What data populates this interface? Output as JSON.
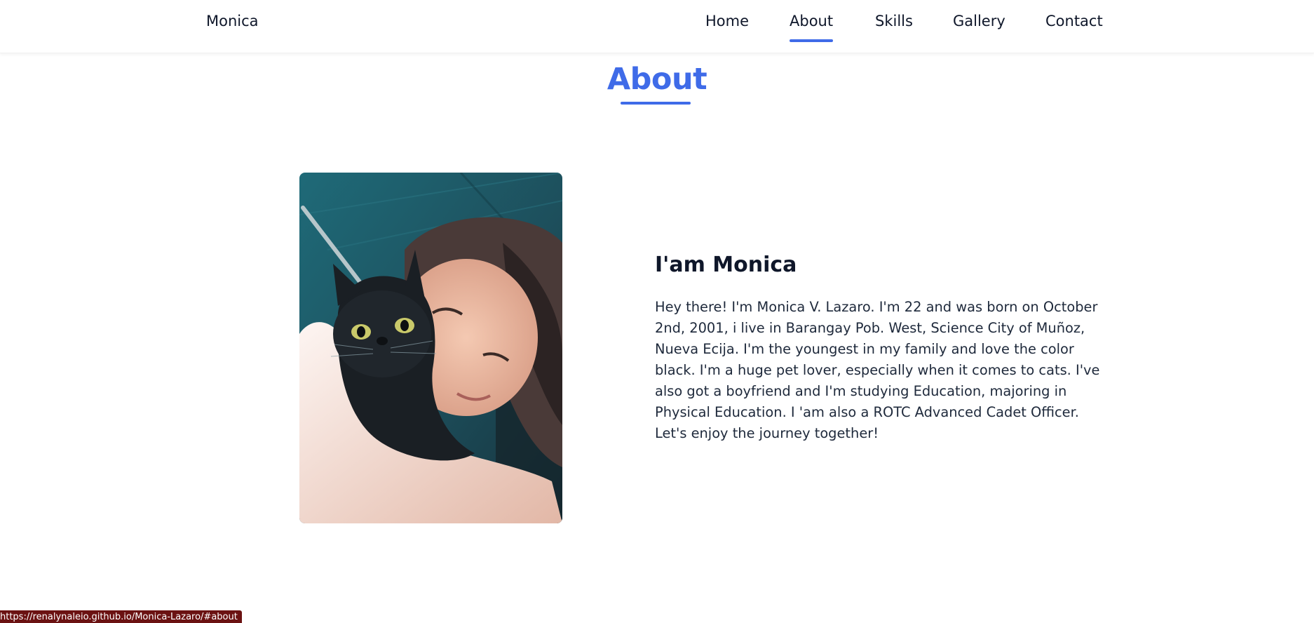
{
  "header": {
    "logo": "Monica",
    "nav": [
      {
        "label": "Home",
        "active": false
      },
      {
        "label": "About",
        "active": true
      },
      {
        "label": "Skills",
        "active": false
      },
      {
        "label": "Gallery",
        "active": false
      },
      {
        "label": "Contact",
        "active": false
      }
    ]
  },
  "about": {
    "section_title": "About",
    "heading": "I'am Monica",
    "bio": "Hey there! I'm Monica V. Lazaro. I'm 22 and was born on October 2nd, 2001, i live in Barangay Pob. West, Science City of Muñoz, Nueva Ecija. I'm the youngest in my family and love the color black. I'm a huge pet lover, especially when it comes to cats. I've also got a boyfriend and I'm studying Education, majoring in Physical Education. I 'am also a ROTC Advanced Cadet Officer. Let's enjoy the journey together!"
  },
  "status_bar": {
    "url": "https://renalynaleio.github.io/Monica-Lazaro/#about"
  },
  "colors": {
    "accent": "#3f6be8",
    "text_dark": "#0f172a",
    "status_bg": "#6b1212"
  }
}
